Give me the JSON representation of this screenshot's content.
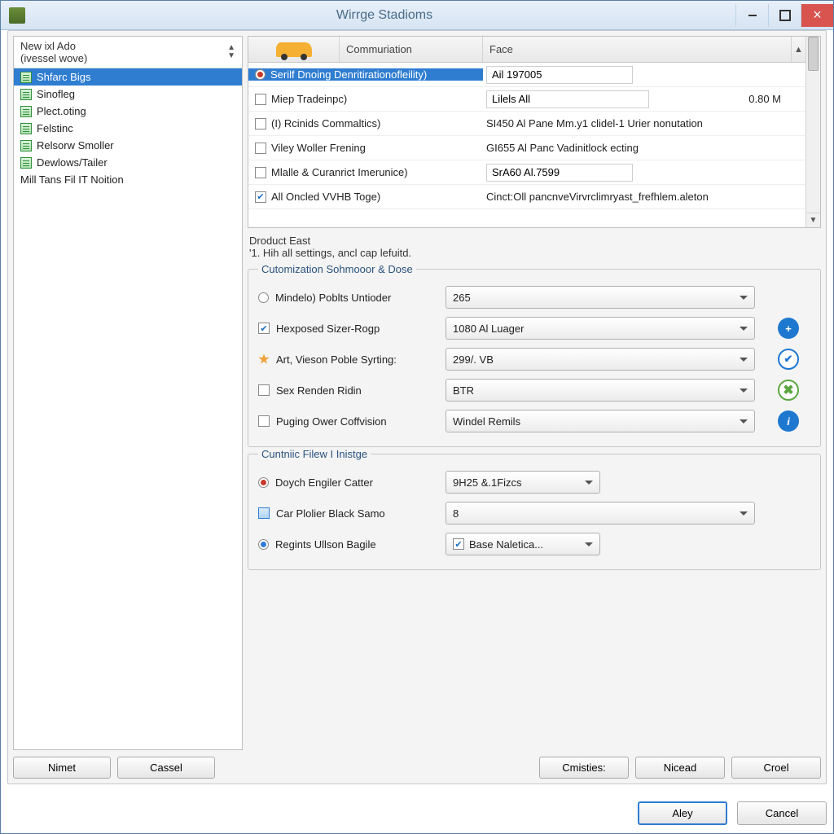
{
  "window": {
    "title": "Wirrge Stadioms"
  },
  "sidebar": {
    "header_line1": "New ixl Ado",
    "header_line2": "(ivessel wove)",
    "items": [
      "Shfarc Bigs",
      "Sinofleg",
      "Plect.oting",
      "Felstinc",
      "Relsorw Smoller",
      "Dewlows/Tailer",
      "Mill Tans Fil IT Noition"
    ]
  },
  "grid": {
    "col2": "Commuriation",
    "col3": "Face",
    "rows": [
      {
        "checked": false,
        "selected": true,
        "radio": true,
        "label": "Serilf Dnoing Denritirationofleility)",
        "value": "Ail 197005",
        "extra": ""
      },
      {
        "checked": false,
        "label": "Miep Tradeinpc)",
        "value": "Lilels All",
        "extra": "0.80 M"
      },
      {
        "checked": false,
        "label": "(I) Rcinids Commaltics)",
        "value": "SI450 Al Pane Mm.y1 clidel-1 Urier nonutation",
        "full": true
      },
      {
        "checked": false,
        "label": "Viley Woller Frening",
        "value": "GI655 Al Panc Vadinitlock ecting",
        "full": true
      },
      {
        "checked": false,
        "label": "Mlalle & Curanrict Imerunice)",
        "value": "SrA60 Al.7599"
      },
      {
        "checked": true,
        "label": "All Oncled VVHB Toge)",
        "value": "Cinct:Oll pancnveVirvrclimryast_frefhlem.aleton",
        "full": true
      }
    ]
  },
  "desc": {
    "title": "Droduct East",
    "sub": "'1. Hih all settings, ancl cap lefuitd."
  },
  "group1": {
    "legend": "Cutomization Sohmooor & Dose",
    "rows": [
      {
        "type": "radio",
        "label": "Mindelo) Poblts Untioder",
        "sel": "265"
      },
      {
        "type": "check",
        "checked": true,
        "label": "Hexposed Sizer-Rogp",
        "sel": "1080 Al Luager",
        "extra": "add"
      },
      {
        "type": "star",
        "label": "Art, Vieson Poble Syrting:",
        "sel": "299/. VB",
        "extra": "ok"
      },
      {
        "type": "check",
        "checked": false,
        "label": "Sex Renden Ridin",
        "sel": "BTR",
        "extra": "del"
      },
      {
        "type": "check",
        "checked": false,
        "label": "Puging Ower Coffvision",
        "sel": "Windel Remils",
        "extra": "info"
      }
    ]
  },
  "group2": {
    "legend": "Cuntniic Filew I Inistge",
    "rows": [
      {
        "type": "radio",
        "radsel": true,
        "label": "Doych Engiler Catter",
        "sel": "9H25 &.1Fizcs",
        "w": "short"
      },
      {
        "type": "sq",
        "label": "Car Plolier Black Samo",
        "sel": "8",
        "w": "long"
      },
      {
        "type": "radio",
        "radsel": true,
        "blue": true,
        "label": "Regints Ullson Bagile",
        "sel": "Base Naletica...",
        "w": "short",
        "cb": true
      }
    ]
  },
  "buttons": {
    "sidebar1": "Nimet",
    "sidebar2": "Cassel",
    "main1": "Cmisties:",
    "main2": "Nicead",
    "main3": "Croel",
    "footer_ok": "Aley",
    "footer_cancel": "Cancel"
  }
}
